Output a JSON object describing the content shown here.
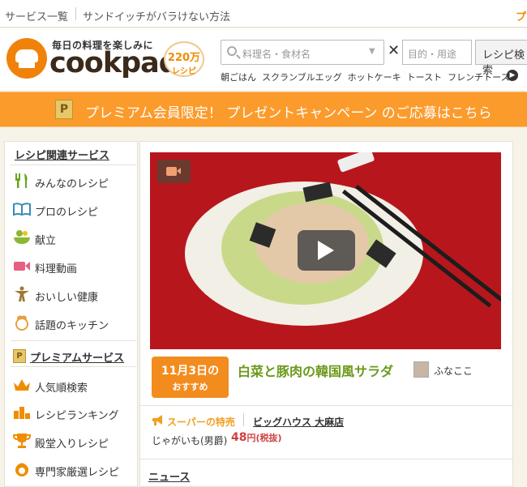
{
  "topbar": {
    "link1": "サービス一覧",
    "link2": "サンドイッチがバラけない方法",
    "premium_cut": "プ"
  },
  "header": {
    "tagline": "毎日の料理を楽しみに",
    "wordmark": "cookpad",
    "badge_number": "220万",
    "badge_unit": "レシピ",
    "search_placeholder": "料理名・食材名",
    "times": "✕",
    "purpose_placeholder": "目的・用途",
    "search_button": "レシピ検索",
    "keywords": [
      "朝ごはん",
      "スクランブルエッグ",
      "ホットケーキ",
      "トースト",
      "フレンチトースト"
    ]
  },
  "banner": {
    "icon": "P",
    "text": "プレミアム会員限定！ プレゼントキャンペーン のご応募はこちら"
  },
  "sidebar": {
    "section1_title": "レシピ関連サービス",
    "section1_items": [
      {
        "label": "みんなのレシピ",
        "icon": "fork-knife-icon",
        "color": "#6aa520"
      },
      {
        "label": "プロのレシピ",
        "icon": "book-icon",
        "color": "#3a8ab8"
      },
      {
        "label": "献立",
        "icon": "bowl-icon",
        "color": "#8ab830"
      },
      {
        "label": "料理動画",
        "icon": "video-camera-icon",
        "color": "#e86080"
      },
      {
        "label": "おいしい健康",
        "icon": "person-icon",
        "color": "#a07830"
      },
      {
        "label": "話題のキッチン",
        "icon": "chef-icon",
        "color": "#e8a040"
      }
    ],
    "section2_icon": "P",
    "section2_title": "プレミアムサービス",
    "section2_items": [
      {
        "label": "人気順検索",
        "icon": "crown-icon",
        "color": "#f08c00"
      },
      {
        "label": "レシピランキング",
        "icon": "ranking-icon",
        "color": "#f08c00"
      },
      {
        "label": "殿堂入りレシピ",
        "icon": "trophy-icon",
        "color": "#f08c00"
      },
      {
        "label": "専門家厳選レシピ",
        "icon": "expert-icon",
        "color": "#f08c00"
      }
    ]
  },
  "main": {
    "recommend_date": "11月3日の",
    "recommend_label": "おすすめ",
    "recipe_title": "白菜と豚肉の韓国風サラダ",
    "author": "ふなここ",
    "sale_label": "スーパーの特売",
    "sale_store": "ビッグハウス 大麻店",
    "sale_item": "じゃがいも(男爵)",
    "sale_price": "48",
    "sale_price_unit": "円(税抜)",
    "news_title": "ニュース"
  },
  "colors": {
    "brand_orange": "#f0820a",
    "banner": "#fb9b2c",
    "recipe_green": "#6a9a1a",
    "price_red": "#d04040"
  }
}
